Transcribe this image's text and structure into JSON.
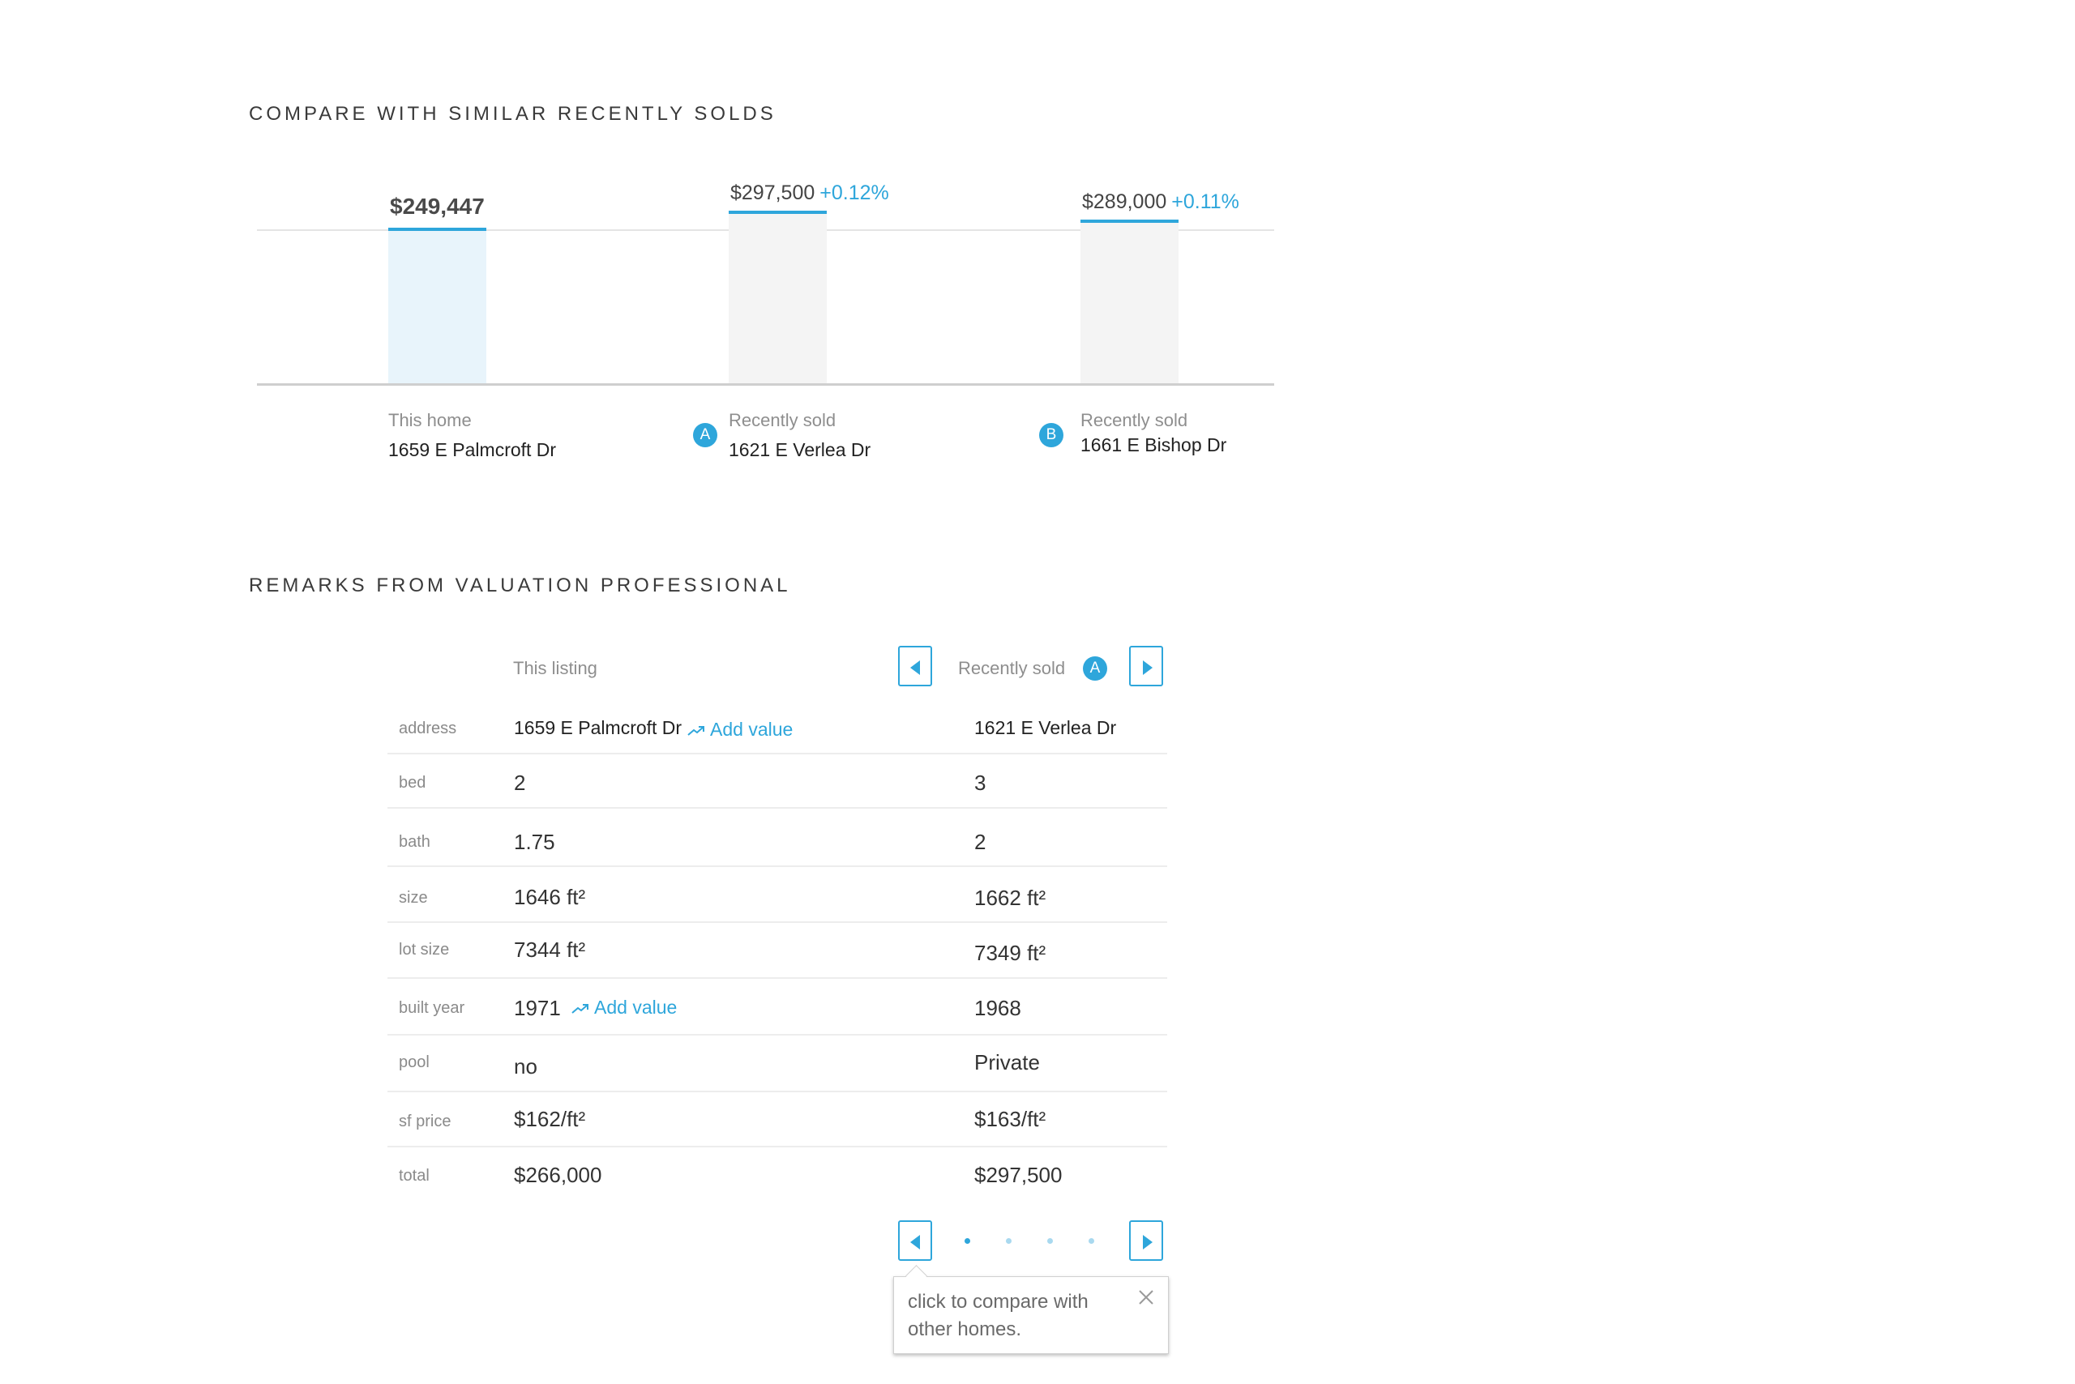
{
  "compare": {
    "title": "COMPARE WITH SIMILAR RECENTLY SOLDS",
    "colors": {
      "accent": "#2ea6db",
      "this_home_bar": "#e8f4fb",
      "sold_bar": "#f4f4f4"
    },
    "homes": [
      {
        "price": "$249,447",
        "change": "",
        "caption": "This home",
        "address": "1659 E Palmcroft Dr",
        "marker": ""
      },
      {
        "price": "$297,500",
        "change": "+0.12%",
        "caption": "Recently sold",
        "address": "1621 E Verlea Dr",
        "marker": "A"
      },
      {
        "price": "$289,000",
        "change": "+0.11%",
        "caption": "Recently sold",
        "address": "1661 E Bishop Dr",
        "marker": "B"
      }
    ]
  },
  "chart_data": {
    "type": "bar",
    "categories": [
      "1659 E Palmcroft Dr",
      "1621 E Verlea Dr",
      "1661 E Bishop Dr"
    ],
    "values": [
      249447,
      297500,
      289000
    ],
    "title": "COMPARE WITH SIMILAR RECENTLY SOLDS"
  },
  "remarks": {
    "title": "REMARKS FROM VALUATION PROFESSIONAL",
    "this_listing_label": "This listing",
    "compare_label": "Recently sold",
    "compare_marker": "A",
    "prev_icon": "caret-left-icon",
    "next_icon": "caret-right-icon",
    "add_value_label": "Add value",
    "rows": [
      {
        "label": "address",
        "this": "1659 E Palmcroft Dr",
        "other": "1621 E Verlea Dr"
      },
      {
        "label": "bed",
        "this": "2",
        "other": "3"
      },
      {
        "label": "bath",
        "this": "1.75",
        "other": "2"
      },
      {
        "label": "size",
        "this": "1646 ft²",
        "other": "1662 ft²"
      },
      {
        "label": "lot size",
        "this": "7344 ft²",
        "other": "7349 ft²"
      },
      {
        "label": "built year",
        "this": "1971",
        "other": "1968"
      },
      {
        "label": "pool",
        "this": "no",
        "other": "Private"
      },
      {
        "label": "sf price",
        "this": "$162/ft²",
        "other": "$163/ft²"
      },
      {
        "label": "total",
        "this": "$266,000",
        "other": "$297,500"
      }
    ],
    "pagination": {
      "pages": 4,
      "current": 1
    },
    "tooltip": {
      "text": "click to compare with other homes.",
      "close_icon": "close-icon"
    }
  }
}
